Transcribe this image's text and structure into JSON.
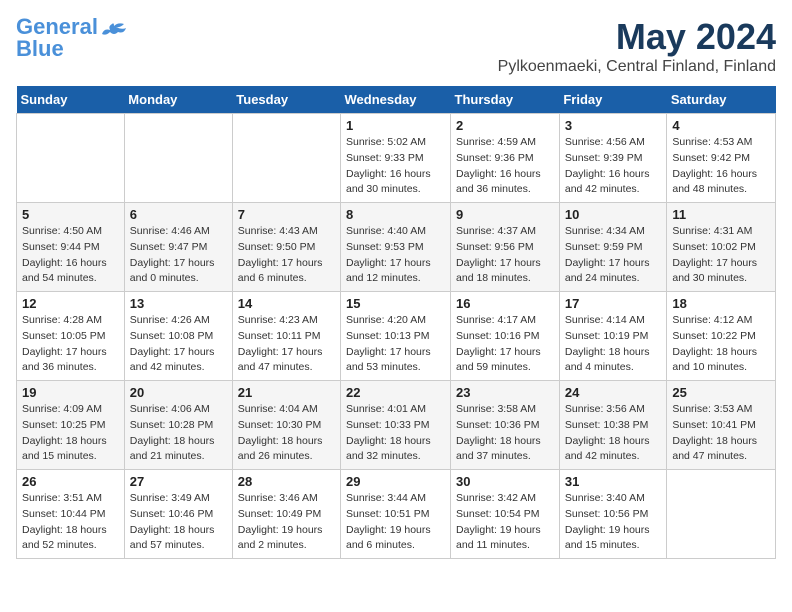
{
  "header": {
    "logo_line1": "General",
    "logo_line2": "Blue",
    "month_title": "May 2024",
    "location": "Pylkoenmaeki, Central Finland, Finland"
  },
  "weekdays": [
    "Sunday",
    "Monday",
    "Tuesday",
    "Wednesday",
    "Thursday",
    "Friday",
    "Saturday"
  ],
  "weeks": [
    [
      {
        "day": "",
        "info": ""
      },
      {
        "day": "",
        "info": ""
      },
      {
        "day": "",
        "info": ""
      },
      {
        "day": "1",
        "info": "Sunrise: 5:02 AM\nSunset: 9:33 PM\nDaylight: 16 hours\nand 30 minutes."
      },
      {
        "day": "2",
        "info": "Sunrise: 4:59 AM\nSunset: 9:36 PM\nDaylight: 16 hours\nand 36 minutes."
      },
      {
        "day": "3",
        "info": "Sunrise: 4:56 AM\nSunset: 9:39 PM\nDaylight: 16 hours\nand 42 minutes."
      },
      {
        "day": "4",
        "info": "Sunrise: 4:53 AM\nSunset: 9:42 PM\nDaylight: 16 hours\nand 48 minutes."
      }
    ],
    [
      {
        "day": "5",
        "info": "Sunrise: 4:50 AM\nSunset: 9:44 PM\nDaylight: 16 hours\nand 54 minutes."
      },
      {
        "day": "6",
        "info": "Sunrise: 4:46 AM\nSunset: 9:47 PM\nDaylight: 17 hours\nand 0 minutes."
      },
      {
        "day": "7",
        "info": "Sunrise: 4:43 AM\nSunset: 9:50 PM\nDaylight: 17 hours\nand 6 minutes."
      },
      {
        "day": "8",
        "info": "Sunrise: 4:40 AM\nSunset: 9:53 PM\nDaylight: 17 hours\nand 12 minutes."
      },
      {
        "day": "9",
        "info": "Sunrise: 4:37 AM\nSunset: 9:56 PM\nDaylight: 17 hours\nand 18 minutes."
      },
      {
        "day": "10",
        "info": "Sunrise: 4:34 AM\nSunset: 9:59 PM\nDaylight: 17 hours\nand 24 minutes."
      },
      {
        "day": "11",
        "info": "Sunrise: 4:31 AM\nSunset: 10:02 PM\nDaylight: 17 hours\nand 30 minutes."
      }
    ],
    [
      {
        "day": "12",
        "info": "Sunrise: 4:28 AM\nSunset: 10:05 PM\nDaylight: 17 hours\nand 36 minutes."
      },
      {
        "day": "13",
        "info": "Sunrise: 4:26 AM\nSunset: 10:08 PM\nDaylight: 17 hours\nand 42 minutes."
      },
      {
        "day": "14",
        "info": "Sunrise: 4:23 AM\nSunset: 10:11 PM\nDaylight: 17 hours\nand 47 minutes."
      },
      {
        "day": "15",
        "info": "Sunrise: 4:20 AM\nSunset: 10:13 PM\nDaylight: 17 hours\nand 53 minutes."
      },
      {
        "day": "16",
        "info": "Sunrise: 4:17 AM\nSunset: 10:16 PM\nDaylight: 17 hours\nand 59 minutes."
      },
      {
        "day": "17",
        "info": "Sunrise: 4:14 AM\nSunset: 10:19 PM\nDaylight: 18 hours\nand 4 minutes."
      },
      {
        "day": "18",
        "info": "Sunrise: 4:12 AM\nSunset: 10:22 PM\nDaylight: 18 hours\nand 10 minutes."
      }
    ],
    [
      {
        "day": "19",
        "info": "Sunrise: 4:09 AM\nSunset: 10:25 PM\nDaylight: 18 hours\nand 15 minutes."
      },
      {
        "day": "20",
        "info": "Sunrise: 4:06 AM\nSunset: 10:28 PM\nDaylight: 18 hours\nand 21 minutes."
      },
      {
        "day": "21",
        "info": "Sunrise: 4:04 AM\nSunset: 10:30 PM\nDaylight: 18 hours\nand 26 minutes."
      },
      {
        "day": "22",
        "info": "Sunrise: 4:01 AM\nSunset: 10:33 PM\nDaylight: 18 hours\nand 32 minutes."
      },
      {
        "day": "23",
        "info": "Sunrise: 3:58 AM\nSunset: 10:36 PM\nDaylight: 18 hours\nand 37 minutes."
      },
      {
        "day": "24",
        "info": "Sunrise: 3:56 AM\nSunset: 10:38 PM\nDaylight: 18 hours\nand 42 minutes."
      },
      {
        "day": "25",
        "info": "Sunrise: 3:53 AM\nSunset: 10:41 PM\nDaylight: 18 hours\nand 47 minutes."
      }
    ],
    [
      {
        "day": "26",
        "info": "Sunrise: 3:51 AM\nSunset: 10:44 PM\nDaylight: 18 hours\nand 52 minutes."
      },
      {
        "day": "27",
        "info": "Sunrise: 3:49 AM\nSunset: 10:46 PM\nDaylight: 18 hours\nand 57 minutes."
      },
      {
        "day": "28",
        "info": "Sunrise: 3:46 AM\nSunset: 10:49 PM\nDaylight: 19 hours\nand 2 minutes."
      },
      {
        "day": "29",
        "info": "Sunrise: 3:44 AM\nSunset: 10:51 PM\nDaylight: 19 hours\nand 6 minutes."
      },
      {
        "day": "30",
        "info": "Sunrise: 3:42 AM\nSunset: 10:54 PM\nDaylight: 19 hours\nand 11 minutes."
      },
      {
        "day": "31",
        "info": "Sunrise: 3:40 AM\nSunset: 10:56 PM\nDaylight: 19 hours\nand 15 minutes."
      },
      {
        "day": "",
        "info": ""
      }
    ]
  ]
}
